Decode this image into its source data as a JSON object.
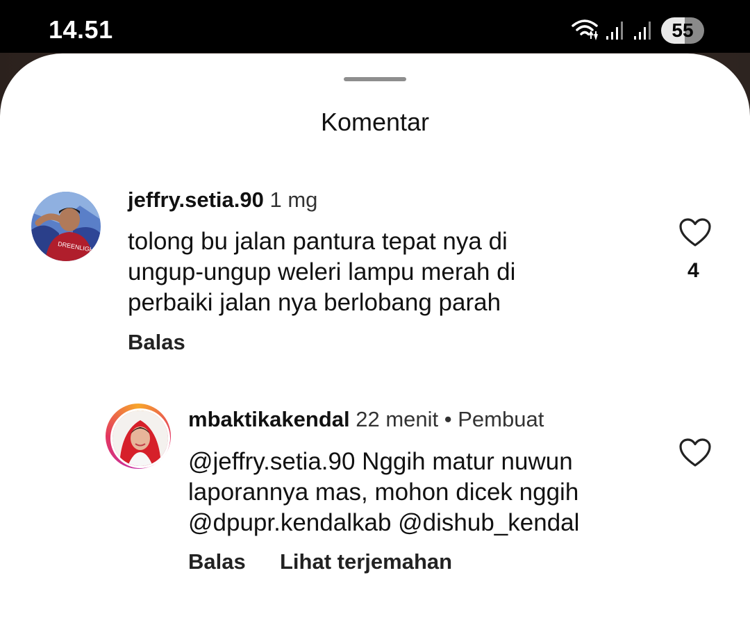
{
  "status_bar": {
    "time": "14.51",
    "battery_level": "55",
    "icons": [
      "wifi-icon",
      "signal-icon",
      "signal-icon"
    ]
  },
  "sheet": {
    "title": "Komentar"
  },
  "comments": [
    {
      "username": "jeffry.setia.90",
      "timestamp": "1 mg",
      "lines": [
        "tolong bu jalan pantura tepat nya di",
        "ungup-ungup weleri lampu merah di",
        "perbaiki jalan nya berlobang parah"
      ],
      "reply_label": "Balas",
      "like_count": "4"
    }
  ],
  "replies": [
    {
      "username": "mbaktikakendal",
      "timestamp": "22 menit",
      "separator": "•",
      "badge": "Pembuat",
      "lines": [
        "@jeffry.setia.90 Nggih matur nuwun",
        "laporannya mas, mohon dicek nggih",
        "@dpupr.kendalkab @dishub_kendal"
      ],
      "reply_label": "Balas",
      "translate_label": "Lihat terjemahan"
    }
  ],
  "colors": {
    "background": "#ffffff",
    "text": "#111111",
    "status_bar": "#000000",
    "story_ring_start": "#f7a62b",
    "story_ring_end": "#c62fa3"
  }
}
